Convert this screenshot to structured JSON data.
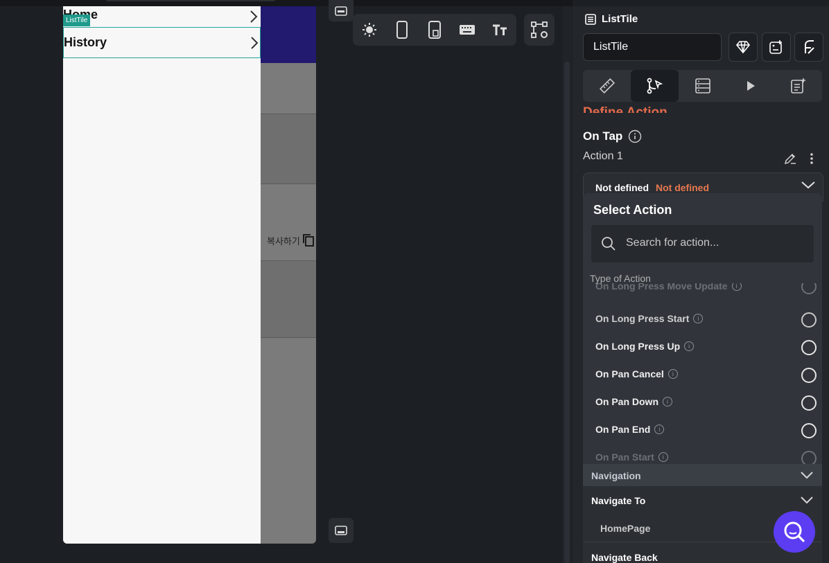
{
  "preview": {
    "drawer_items": [
      {
        "label": "Home"
      },
      {
        "label": "History"
      }
    ],
    "selected_tag": "ListTile",
    "copy_text": "복사하기"
  },
  "toolbar": {
    "icons": [
      "sun-icon",
      "phone-icon",
      "tablet-icon",
      "keyboard-icon",
      "text-size-icon",
      "graph-settings-icon"
    ]
  },
  "panel": {
    "title": "ListTile",
    "name_value": "ListTile",
    "section_heading": "Define Action",
    "trigger": "On Tap",
    "action_label": "Action 1",
    "action_status": {
      "label": "Not defined",
      "value": "Not defined"
    },
    "dropdown": {
      "title": "Select Action",
      "search_placeholder": "Search for action...",
      "type_label": "Type of Action",
      "options": [
        {
          "label": "On Long Press Move Update",
          "state": "fade"
        },
        {
          "label": "On Long Press Start",
          "state": "dim"
        },
        {
          "label": "On Long Press Up",
          "state": "normal"
        },
        {
          "label": "On Pan Cancel",
          "state": "normal"
        },
        {
          "label": "On Pan Down",
          "state": "normal"
        },
        {
          "label": "On Pan End",
          "state": "normal"
        },
        {
          "label": "On Pan Start",
          "state": "fade"
        }
      ],
      "category": "Navigation",
      "navigate_to": "Navigate To",
      "navigate_to_value": "HomePage",
      "navigate_back": "Navigate Back"
    }
  },
  "colors": {
    "accent": "#e36a4c",
    "status": "#e8784f",
    "appbar": "#221a6e",
    "tile_border": "#27a39a",
    "fab": "#5c3df2"
  }
}
